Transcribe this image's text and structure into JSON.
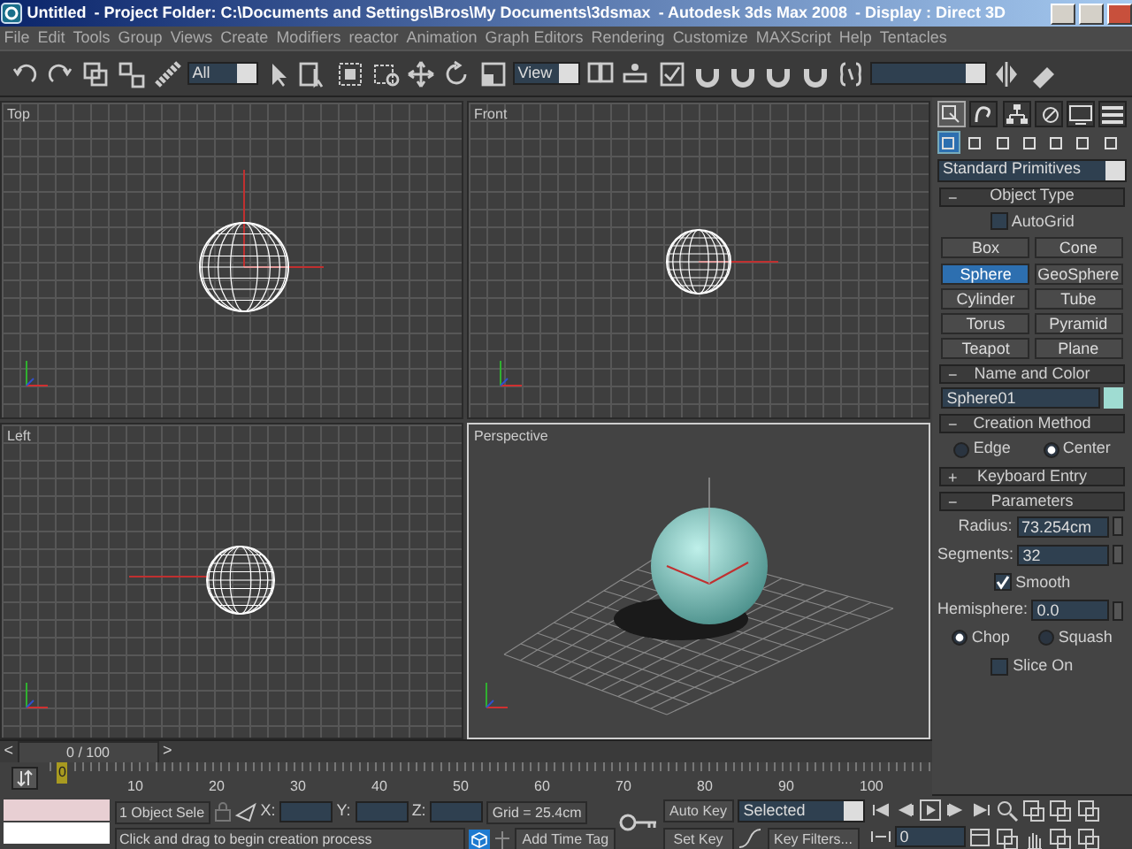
{
  "window": {
    "title_parts": [
      "Untitled",
      "- Project Folder: C:\\Documents and Settings\\Bros\\My Documents\\3dsmax",
      "- Autodesk 3ds Max 2008",
      "- Display : Direct 3D"
    ]
  },
  "menu": [
    "File",
    "Edit",
    "Tools",
    "Group",
    "Views",
    "Create",
    "Modifiers",
    "reactor",
    "Animation",
    "Graph Editors",
    "Rendering",
    "Customize",
    "MAXScript",
    "Help",
    "Tentacles"
  ],
  "toolbar": {
    "selection_filter": "All",
    "reference_coordinate": "View"
  },
  "viewports": [
    {
      "label": "Top",
      "kind": "top",
      "active": false
    },
    {
      "label": "Front",
      "kind": "front",
      "active": false
    },
    {
      "label": "Left",
      "kind": "left",
      "active": false
    },
    {
      "label": "Perspective",
      "kind": "perspective",
      "active": true
    }
  ],
  "command_panel": {
    "tabs": [
      {
        "selected": true
      },
      {
        "selected": false
      },
      {
        "selected": false
      },
      {
        "selected": false
      },
      {
        "selected": false
      },
      {
        "selected": false
      }
    ],
    "categories": [
      {
        "selected": true
      },
      {
        "selected": false
      },
      {
        "selected": false
      },
      {
        "selected": false
      },
      {
        "selected": false
      },
      {
        "selected": false
      },
      {
        "selected": false
      }
    ],
    "object_class": "Standard Primitives",
    "object_type": {
      "toggle": "−",
      "title": "Object Type",
      "autogrid": {
        "label": "AutoGrid",
        "checked": false
      },
      "buttons": [
        {
          "label": "Box",
          "selected": false
        },
        {
          "label": "Cone",
          "selected": false
        },
        {
          "label": "Sphere",
          "selected": true
        },
        {
          "label": "GeoSphere",
          "selected": false
        },
        {
          "label": "Cylinder",
          "selected": false
        },
        {
          "label": "Tube",
          "selected": false
        },
        {
          "label": "Torus",
          "selected": false
        },
        {
          "label": "Pyramid",
          "selected": false
        },
        {
          "label": "Teapot",
          "selected": false
        },
        {
          "label": "Plane",
          "selected": false
        }
      ]
    },
    "name_and_color": {
      "toggle": "−",
      "title": "Name and Color",
      "name": "Sphere01",
      "color": "#9fdcd2"
    },
    "creation_method": {
      "toggle": "−",
      "title": "Creation Method",
      "options": [
        {
          "label": "Edge",
          "selected": false
        },
        {
          "label": "Center",
          "selected": true
        }
      ]
    },
    "keyboard_entry": {
      "toggle": "+",
      "title": "Keyboard Entry"
    },
    "parameters": {
      "toggle": "−",
      "title": "Parameters",
      "fields": [
        {
          "label": "Radius:",
          "value": "73.254cm"
        },
        {
          "label": "Segments:",
          "value": "32"
        }
      ],
      "smooth": {
        "label": "Smooth",
        "checked": true
      },
      "hemisphere": {
        "label": "Hemisphere:",
        "value": "0.0"
      },
      "options": [
        {
          "label": "Chop",
          "selected": true
        },
        {
          "label": "Squash",
          "selected": false
        }
      ],
      "slice_on": {
        "label": "Slice On",
        "checked": false
      }
    }
  },
  "time_slider": {
    "prev": "<",
    "position": "0 / 100",
    "next": ">"
  },
  "track_bar": {
    "frame": "0",
    "ticks": [
      "10",
      "20",
      "30",
      "40",
      "50",
      "60",
      "70",
      "80",
      "90",
      "100"
    ]
  },
  "status_bar": {
    "selection": "1 Object Sele",
    "x_label": "X:",
    "y_label": "Y:",
    "z_label": "Z:",
    "grid": "Grid = 25.4cm",
    "prompt": "Click and drag to begin creation process",
    "add_time_tag": "Add Time Tag",
    "auto_key": "Auto Key",
    "set_key": "Set Key",
    "key_mode": "Selected",
    "key_filters": "Key Filters...",
    "frame": "0"
  }
}
